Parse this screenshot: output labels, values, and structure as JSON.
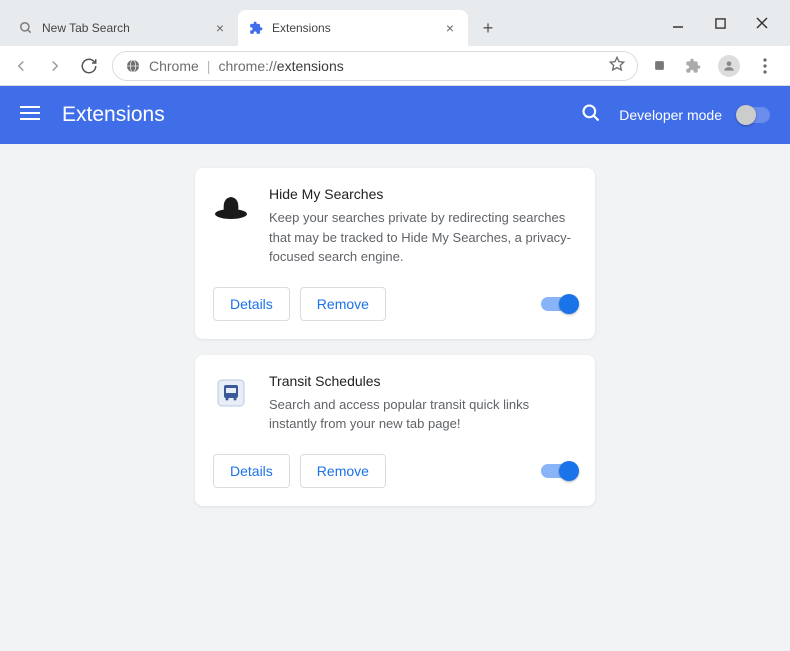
{
  "tabs": [
    {
      "title": "New Tab Search",
      "active": false
    },
    {
      "title": "Extensions",
      "active": true
    }
  ],
  "omnibox": {
    "browser_label": "Chrome",
    "path_prefix": "chrome://",
    "path": "extensions"
  },
  "header": {
    "title": "Extensions",
    "developer_mode_label": "Developer mode",
    "developer_mode_on": false
  },
  "buttons": {
    "details": "Details",
    "remove": "Remove"
  },
  "extensions": [
    {
      "name": "Hide My Searches",
      "description": "Keep your searches private by redirecting searches that may be tracked to Hide My Searches, a privacy-focused search engine.",
      "icon": "hat-icon",
      "enabled": true
    },
    {
      "name": "Transit Schedules",
      "description": "Search and access popular transit quick links instantly from your new tab page!",
      "icon": "bus-icon",
      "enabled": true
    }
  ]
}
